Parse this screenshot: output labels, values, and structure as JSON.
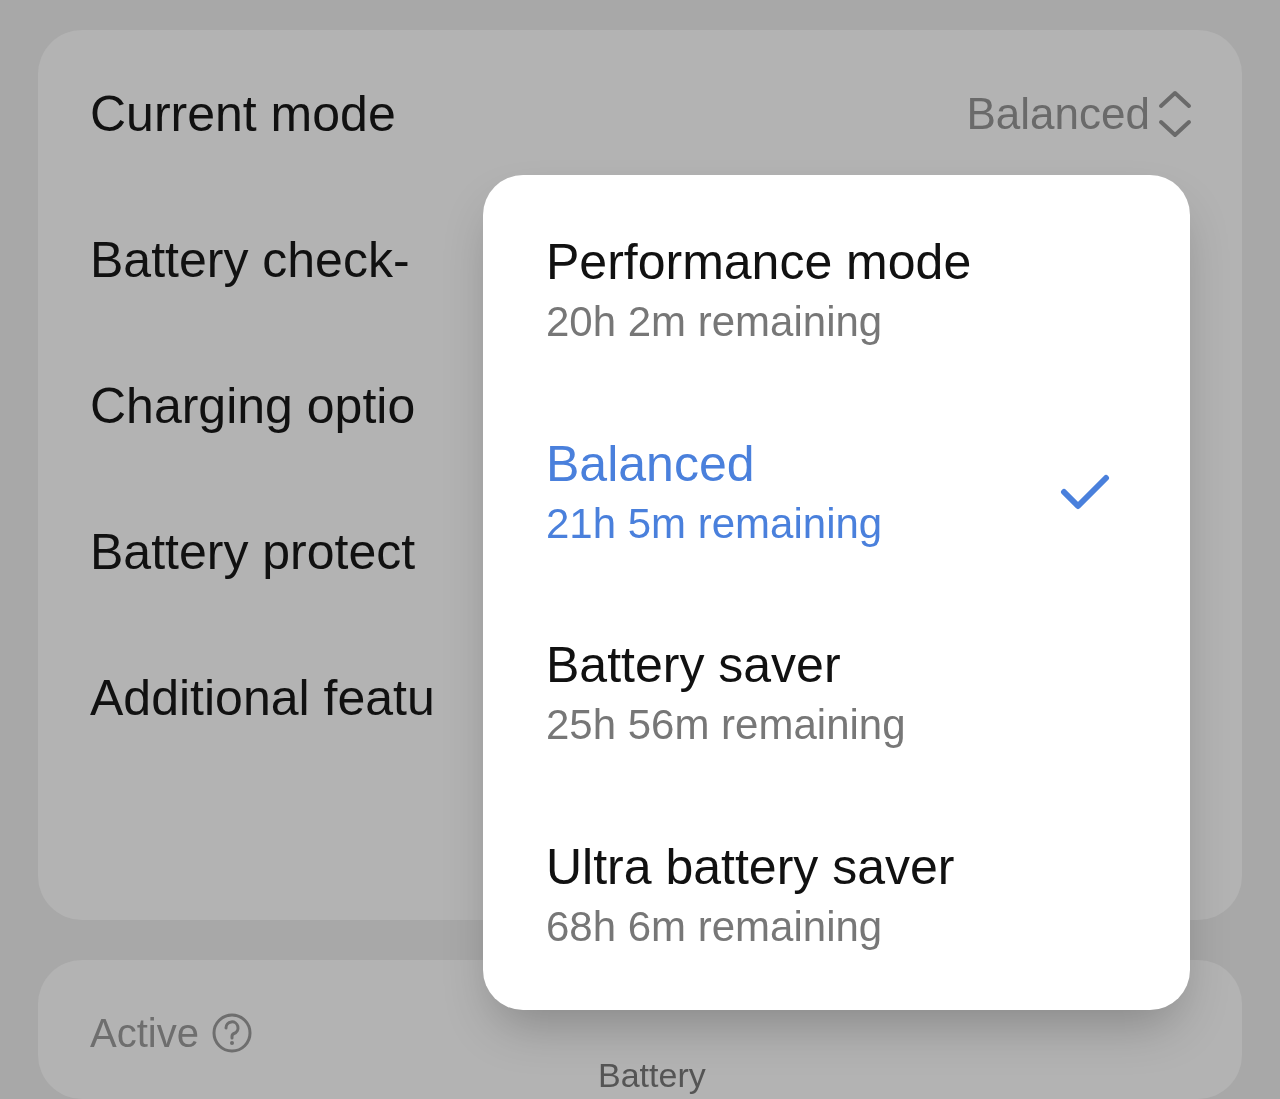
{
  "settings_card": {
    "rows": [
      {
        "label": "Current mode",
        "value": "Balanced"
      },
      {
        "label": "Battery check-"
      },
      {
        "label": "Charging optio"
      },
      {
        "label": "Battery protect"
      },
      {
        "label": "Additional featu"
      }
    ]
  },
  "mode_menu": {
    "options": [
      {
        "title": "Performance mode",
        "subtitle": "20h 2m remaining",
        "selected": false
      },
      {
        "title": "Balanced",
        "subtitle": "21h 5m remaining",
        "selected": true
      },
      {
        "title": "Battery saver",
        "subtitle": "25h 56m remaining",
        "selected": false
      },
      {
        "title": "Ultra battery saver",
        "subtitle": "68h 6m remaining",
        "selected": false
      }
    ]
  },
  "active_card": {
    "heading": "Active",
    "partial_label": "Battery"
  }
}
